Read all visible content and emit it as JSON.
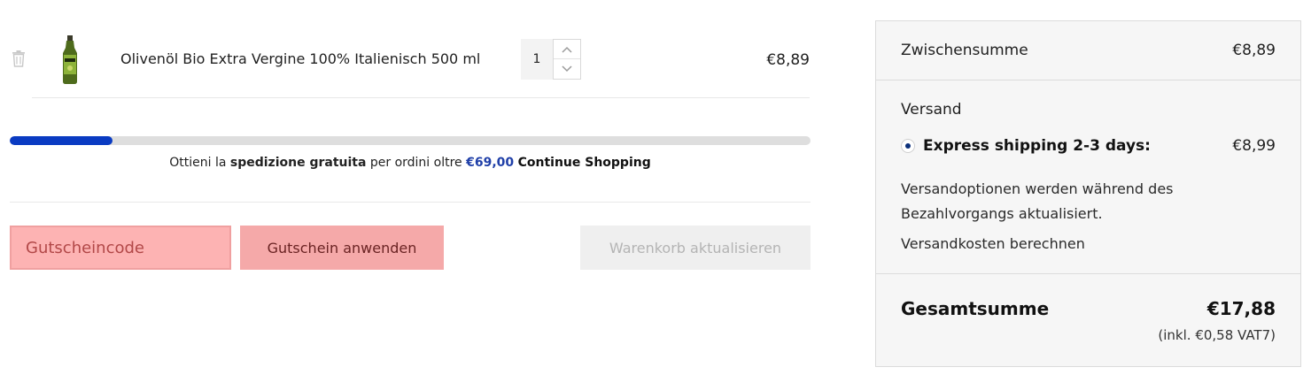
{
  "cart": {
    "item": {
      "name": "Olivenöl Bio Extra Vergine 100% Italienisch 500 ml",
      "quantity": "1",
      "price": "€8,89",
      "icon_remove": "trash-icon",
      "icon_image": "olive-oil-bottle-image"
    },
    "progress": {
      "fraction": 0.128,
      "color": "#0a3bc2"
    },
    "free_shipping": {
      "prefix": "Ottieni la",
      "bold": "spedizione gratuita",
      "middle": "per ordini oltre",
      "amount": "€69,00",
      "link": "Continue Shopping"
    },
    "coupon": {
      "placeholder": "Gutscheincode",
      "apply_label": "Gutschein anwenden"
    },
    "update_label": "Warenkorb aktualisieren"
  },
  "totals": {
    "subtotal_label": "Zwischensumme",
    "subtotal_value": "€8,89",
    "shipping_label": "Versand",
    "shipping_option_label": "Express shipping 2-3 days:",
    "shipping_option_price": "€8,99",
    "shipping_note": "Versandoptionen werden während des Bezahlvorgangs aktualisiert.",
    "shipping_calc": "Versandkosten berechnen",
    "total_label": "Gesamtsumme",
    "total_value": "€17,88",
    "vat_note": "(inkl. €0,58 VAT7)"
  }
}
